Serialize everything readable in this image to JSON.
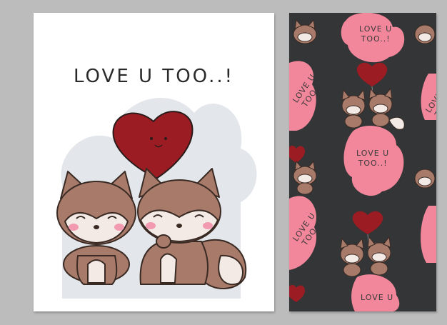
{
  "card": {
    "headline": "LOVE U TOO..!"
  },
  "pattern": {
    "text_1": "LOVE U\nTOO..!",
    "text_2": "LOVE U\nTOO..!",
    "text_3": "LOVE U\nTOO..!",
    "text_4": "LOVE U\nTOO..!",
    "text_5": "LOVE U\nTOO..!",
    "text_6": "LOVE U"
  },
  "colors": {
    "background": "#bcbcbc",
    "card": "#ffffff",
    "cloud": "#e3e6ea",
    "fox_brown": "#a77a6a",
    "fox_light": "#f3eae6",
    "heart_red": "#9b1c22",
    "pattern_bg": "#333537",
    "pattern_pink": "#f2869a"
  }
}
